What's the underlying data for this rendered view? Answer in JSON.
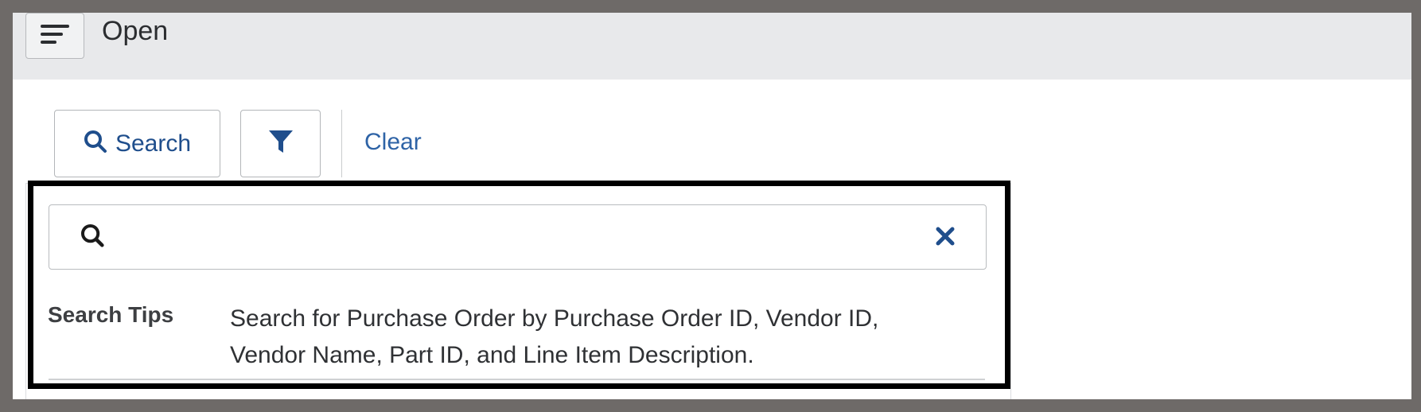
{
  "header": {
    "title": "Open",
    "menu_icon": "hamburger-menu-icon"
  },
  "toolbar": {
    "search_label": "Search",
    "filter_icon": "funnel-icon",
    "clear_label": "Clear"
  },
  "search_panel": {
    "input_value": "",
    "input_placeholder": "",
    "tips_label": "Search Tips",
    "tips_text": "Search for  Purchase Order  by Purchase Order ID, Vendor ID, Vendor Name, Part ID, and Line Item Description."
  },
  "colors": {
    "accent": "#1f4e8c",
    "link": "#2e63a6",
    "header_bg": "#e8e9eb",
    "highlight_border": "#000000"
  }
}
